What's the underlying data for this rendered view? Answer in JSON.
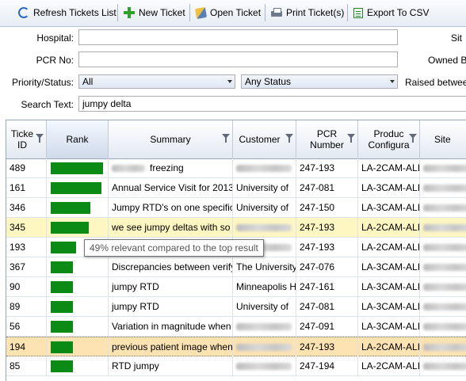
{
  "toolbar": {
    "refresh": "Refresh Tickets List",
    "new": "New Ticket",
    "open": "Open Ticket",
    "print": "Print Ticket(s)",
    "export": "Export To CSV"
  },
  "form": {
    "hospital_label": "Hospital:",
    "hospital_value": "",
    "pcr_label": "PCR No:",
    "pcr_value": "",
    "priority_label": "Priority/Status:",
    "priority_value": "All",
    "status_value": "Any Status",
    "search_label": "Search Text:",
    "search_value": "jumpy delta",
    "site_label": "Sit",
    "owned_label": "Owned B",
    "raised_label": "Raised betwee"
  },
  "grid": {
    "headers": {
      "id": "Ticke ID",
      "rank": "Rank",
      "summary": "Summary",
      "customer": "Customer",
      "pcr": "PCR Number",
      "product": "Produc Configura",
      "site": "Site"
    },
    "rows": [
      {
        "id": "489",
        "rank": 1.0,
        "summary": "freezing",
        "summary_blur": true,
        "customer": "",
        "pcr": "247-193",
        "product": "LA-2CAM-ALI"
      },
      {
        "id": "161",
        "rank": 0.97,
        "summary": "Annual Service Visit for 2013",
        "customer": "University of",
        "pcr": "247-081",
        "product": "LA-3CAM-ALI"
      },
      {
        "id": "346",
        "rank": 0.75,
        "summary": "Jumpy RTD's on one specific",
        "customer": "University of",
        "pcr": "247-150",
        "product": "LA-3CAM-ALI"
      },
      {
        "id": "345",
        "rank": 0.73,
        "summary": "we see jumpy deltas with so",
        "customer": "",
        "pcr": "247-193",
        "product": "LA-2CAM-ALI"
      },
      {
        "id": "193",
        "rank": 0.49,
        "summary": "",
        "customer": "",
        "pcr": "247-193",
        "product": "LA-2CAM-ALI"
      },
      {
        "id": "367",
        "rank": 0.42,
        "summary": "Discrepancies between verify",
        "customer": "The University",
        "pcr": "247-076",
        "product": "LA-3CAM-ALI"
      },
      {
        "id": "90",
        "rank": 0.42,
        "summary": "jumpy RTD",
        "customer": "Minneapolis H",
        "pcr": "247-161",
        "product": "LA-3CAM-ALI"
      },
      {
        "id": "89",
        "rank": 0.42,
        "summary": "jumpy RTD",
        "customer": "University of",
        "pcr": "247-081",
        "product": "LA-3CAM-ALI"
      },
      {
        "id": "56",
        "rank": 0.42,
        "summary": "Variation in magnitude when",
        "customer": "",
        "pcr": "247-091",
        "product": "LA-3CAM-ALI"
      },
      {
        "id": "194",
        "rank": 0.42,
        "summary": "previous patient image when",
        "customer": "",
        "pcr": "247-193",
        "product": "LA-2CAM-ALI"
      },
      {
        "id": "85",
        "rank": 0.42,
        "summary": "RTD jumpy",
        "customer": "",
        "pcr": "247-194",
        "product": "LA-2CAM-ALI"
      }
    ]
  },
  "tooltip": "49% relevant compared to the top result",
  "colors": {
    "rank_bar": "#0b8a16",
    "highlight_row": "#fff7c2",
    "selected_row": "#fde3b2"
  }
}
